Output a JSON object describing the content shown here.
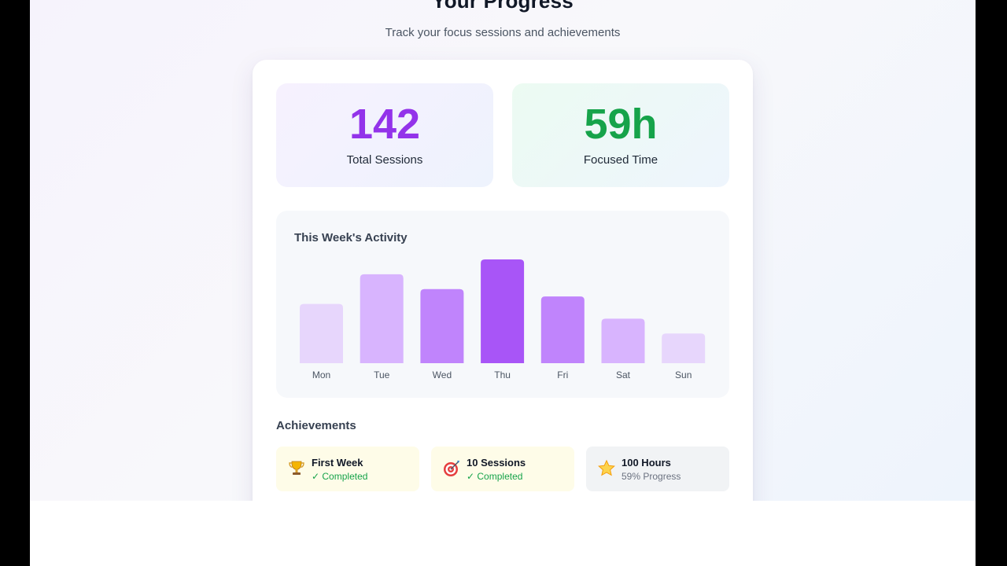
{
  "header": {
    "title": "Your Progress",
    "subtitle": "Track your focus sessions and achievements"
  },
  "stats": {
    "total_sessions": {
      "value": "142",
      "label": "Total Sessions"
    },
    "focused_time": {
      "value": "59h",
      "label": "Focused Time"
    }
  },
  "activity": {
    "title": "This Week's Activity"
  },
  "chart_data": {
    "type": "bar",
    "title": "This Week's Activity",
    "categories": [
      "Mon",
      "Tue",
      "Wed",
      "Thu",
      "Fri",
      "Sat",
      "Sun"
    ],
    "values": [
      4,
      6,
      5,
      7,
      4.5,
      3,
      2
    ],
    "ylim": [
      0,
      7
    ],
    "grid": false,
    "bar_colors": [
      "#e7d6fc",
      "#d8b4fe",
      "#c084fc",
      "#a855f7",
      "#c084fc",
      "#d8b4fe",
      "#e7d6fc"
    ]
  },
  "achievements": {
    "title": "Achievements",
    "items": [
      {
        "icon": "trophy-icon",
        "name": "First Week",
        "status": "✓ Completed",
        "completed": true
      },
      {
        "icon": "target-icon",
        "name": "10 Sessions",
        "status": "✓ Completed",
        "completed": true
      },
      {
        "icon": "star-icon",
        "name": "100 Hours",
        "status": "59% Progress",
        "completed": false,
        "progress": 0.59
      }
    ]
  },
  "colors": {
    "accent_purple": "#9333ea",
    "accent_green": "#16a34a",
    "completed_bg": "#fefce8",
    "pending_bg": "#f1f3f5"
  }
}
